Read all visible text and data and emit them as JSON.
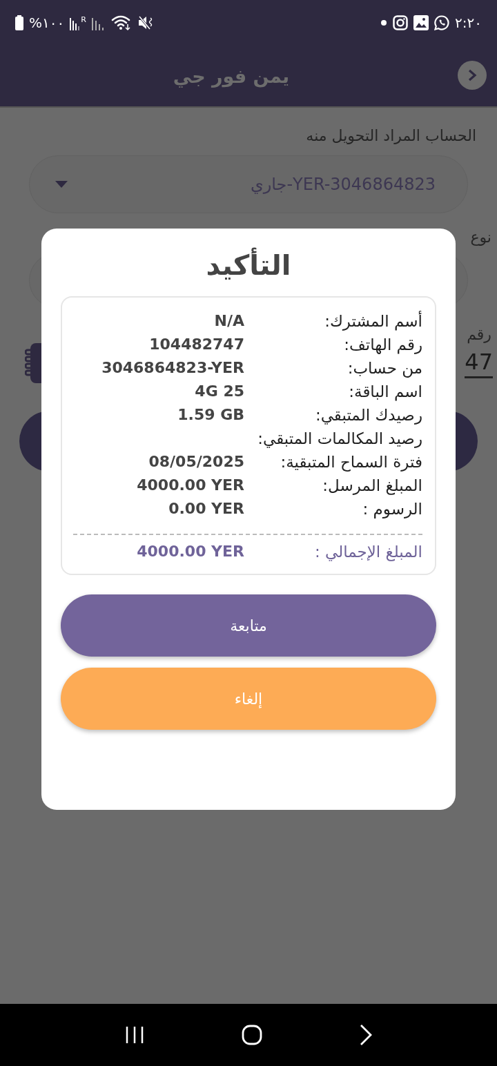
{
  "status_bar": {
    "time": "٢:٢٠",
    "battery": "%١٠٠",
    "network_mark": "R"
  },
  "header": {
    "title": "يمن فور جي"
  },
  "form": {
    "account_label": "الحساب المراد التحويل منه",
    "account_value": "YER-3046864823-جاري",
    "type_label": "نوع",
    "phone_label": "رقم",
    "phone_value": "47"
  },
  "dialog": {
    "title": "التأكيد",
    "rows": [
      {
        "label": "أسم المشترك:",
        "value": "N/A"
      },
      {
        "label": "رقم الهاتف:",
        "value": "104482747"
      },
      {
        "label": "من حساب:",
        "value": "3046864823-YER"
      },
      {
        "label": "اسم الباقة:",
        "value": "4G 25"
      },
      {
        "label": "رصيدك المتبقي:",
        "value": "1.59 GB"
      },
      {
        "label": "رصيد المكالمات المتبقي:"
      },
      {
        "label": "فترة السماح المتبقية:",
        "value": "08/05/2025"
      },
      {
        "label": "المبلغ المرسل:",
        "value": "4000.00 YER"
      },
      {
        "label": "الرسوم :",
        "value": "0.00 YER"
      }
    ],
    "total": {
      "label": "المبلغ الإجمالي :",
      "value": "4000.00 YER"
    },
    "buttons": [
      {
        "label": "متابعة",
        "kind": "primary"
      },
      {
        "label": "إلغاء",
        "kind": "cancel"
      }
    ]
  }
}
